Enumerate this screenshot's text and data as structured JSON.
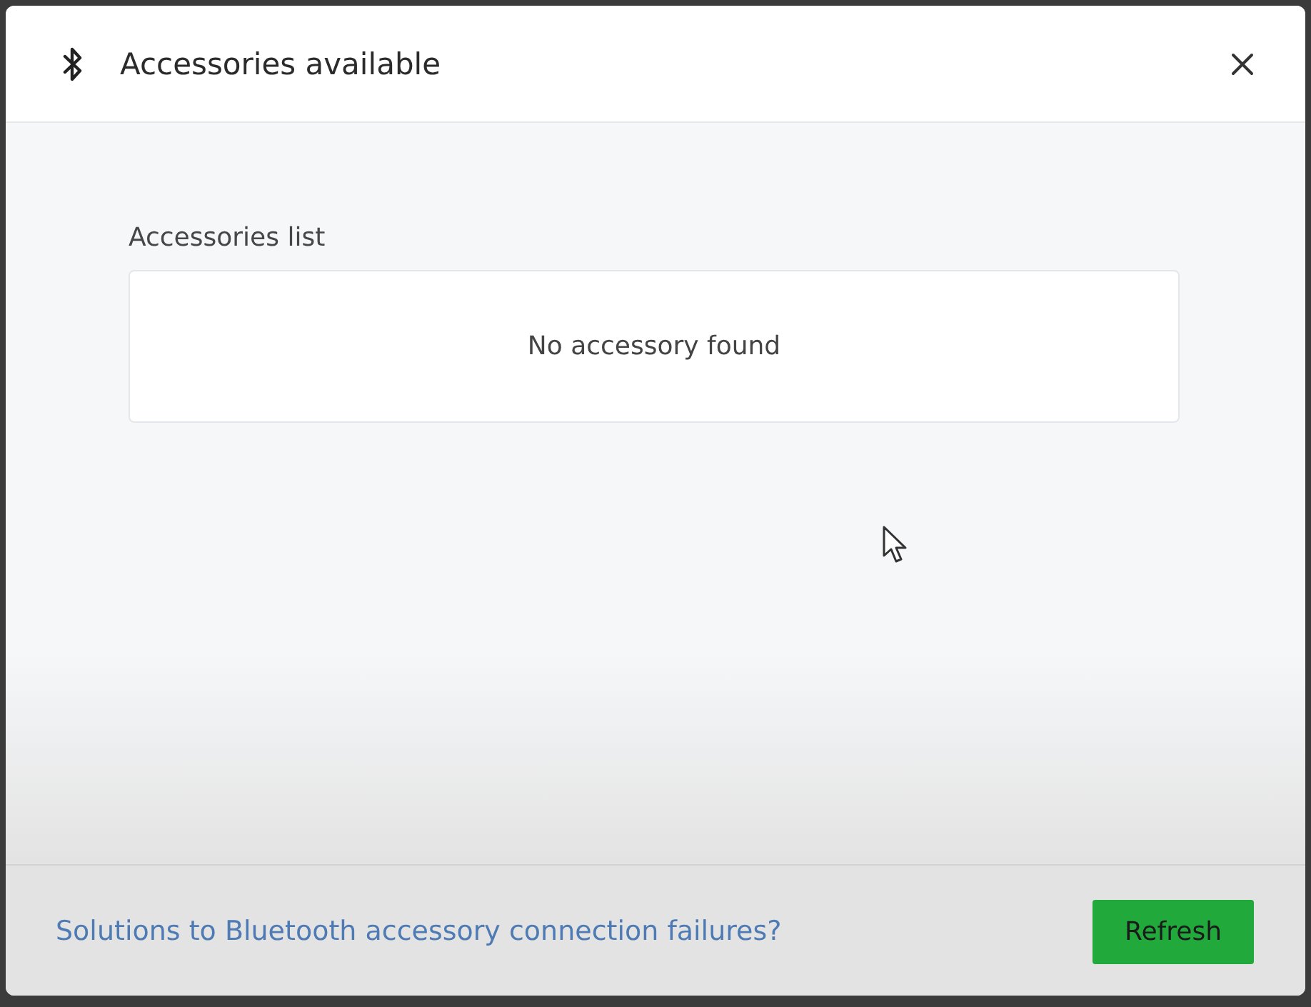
{
  "window": {
    "title": "Accessories available"
  },
  "accessories_list": {
    "label": "Accessories list",
    "empty_message": "No accessory found"
  },
  "footer": {
    "help_link": "Solutions to Bluetooth accessory connection failures?",
    "buttons": [
      "Refresh"
    ]
  }
}
